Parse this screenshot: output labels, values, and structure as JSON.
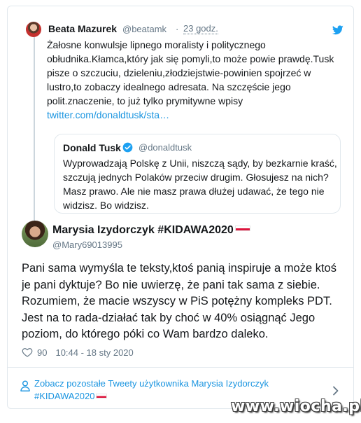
{
  "parent_tweet": {
    "name": "Beata Mazurek",
    "handle": "@beatamk",
    "separator": "·",
    "time": "23 godz.",
    "text": "Żałosne konwulsje lipnego moralisty i politycznego obłudnika.Kłamca,który jak się pomyli,to może powie prawdę.Tusk pisze o szczuciu, dzieleniu,złodziejstwie-powinien spojrzeć w lustro,to zobaczy idealnego adresata. Na szczęście jego polit.znaczenie, to już tylko prymitywne wpisy",
    "link": "twitter.com/donaldtusk/sta…",
    "icon": "twitter-bird-icon"
  },
  "quoted_tweet": {
    "name": "Donald Tusk",
    "handle": "@donaldtusk",
    "text": "Wyprowadzają Polskę z Unii, niszczą sądy, by bezkarnie kraść, szczują jednych Polaków przeciw drugim. Głosujesz na nich? Masz prawo. Ale nie masz prawa dłużej udawać, że tego nie widzisz. Bo widzisz."
  },
  "main_tweet": {
    "name": "Marysia Izydorczyk #KIDAWA2020",
    "handle": "@Mary69013995",
    "text": "Pani sama wymyśla te teksty,ktoś panią inspiruje a może ktoś je pani dyktuje? Bo nie uwierzę, że pani tak sama z siebie. Rozumiem, że macie wszyscy w PiS potężny kompleks PDT. Jest na to rada-działać tak by choć w 40% osiągnąć Jego poziom, do którego póki co Wam bardzo daleko.",
    "likes": "90",
    "timestamp": "10:44 - 18 sty 2020"
  },
  "more_tweets": {
    "label": "Zobacz pozostałe Tweety użytkownika Marysia Izydorczyk #KIDAWA2020"
  },
  "watermark": "www.wiocha.pl",
  "colors": {
    "link": "#1b95e0",
    "muted": "#657786",
    "border": "#e1e8ed",
    "verified": "#1da1f2"
  }
}
